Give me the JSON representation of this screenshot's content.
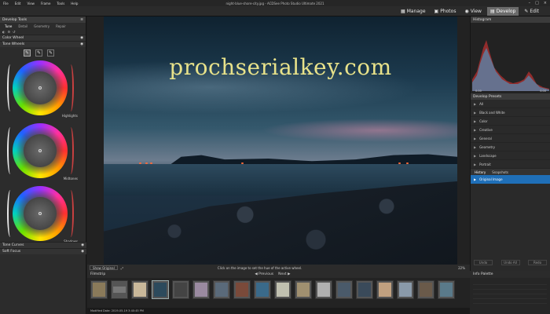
{
  "window": {
    "title": "night-blue-shore-city.jpg - ACDSee Photo Studio Ultimate 2021",
    "menu": [
      "File",
      "Edit",
      "View",
      "Frame",
      "Tools",
      "Help"
    ]
  },
  "modes": [
    {
      "label": "Manage",
      "icon": "manage-icon"
    },
    {
      "label": "Photos",
      "icon": "photos-icon"
    },
    {
      "label": "View",
      "icon": "view-icon"
    },
    {
      "label": "Develop",
      "icon": "develop-icon",
      "active": true
    },
    {
      "label": "Edit",
      "icon": "edit-icon"
    }
  ],
  "left_panel": {
    "title": "Develop Tools",
    "tabs": [
      "Tune",
      "Detail",
      "Geometry",
      "Repair"
    ],
    "sections": {
      "color_wheel": "Color Wheel",
      "tone_wheels": "Tone Wheels",
      "tone_curves": "Tone Curves",
      "soft_focus": "Soft Focus"
    },
    "wheels": [
      "Highlights",
      "Midtones",
      "Shadows"
    ]
  },
  "watermark": "prochserialkey.com",
  "canvas_status": {
    "show_original": "Show Original",
    "hint": "Click on the image to set the hue of the active wheel.",
    "zoom": "22%"
  },
  "right_panel": {
    "histogram_title": "Histogram",
    "hist_left": "0.00",
    "hist_right": "0.00",
    "presets_title": "Develop Presets",
    "presets": [
      "All",
      "Black and White",
      "Color",
      "Creative",
      "General",
      "Geometry",
      "Landscape",
      "Portrait"
    ],
    "history_tabs": [
      "History",
      "Snapshots"
    ],
    "history_item": "Original Image",
    "undo": "Undo",
    "undo_all": "Undo All",
    "redo": "Redo"
  },
  "filmstrip": {
    "title": "Filmstrip",
    "previous": "Previous",
    "next": "Next",
    "status": "Modified Date: 2019-05-19 3:40:45 PM"
  },
  "info_palette": {
    "title": "Info Palette"
  },
  "colors": {
    "accent": "#1f6fb8",
    "watermark": "#e8e28a"
  }
}
